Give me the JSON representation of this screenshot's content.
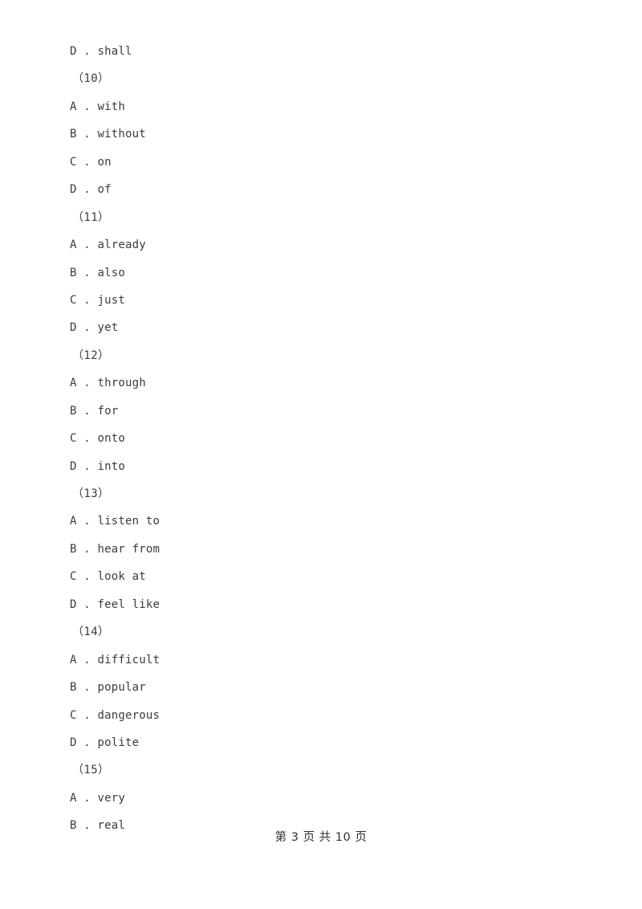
{
  "document": {
    "page_footer": "第 3 页 共 10 页",
    "text_color": "#3b3b3b",
    "background_color": "#ffffff"
  },
  "lines": [
    {
      "type": "option",
      "text": "D . shall"
    },
    {
      "type": "blanknum",
      "text": "（10）"
    },
    {
      "type": "option",
      "text": "A . with"
    },
    {
      "type": "option",
      "text": "B . without"
    },
    {
      "type": "option",
      "text": "C . on"
    },
    {
      "type": "option",
      "text": "D . of"
    },
    {
      "type": "blanknum",
      "text": "（11）"
    },
    {
      "type": "option",
      "text": "A . already"
    },
    {
      "type": "option",
      "text": "B . also"
    },
    {
      "type": "option",
      "text": "C . just"
    },
    {
      "type": "option",
      "text": "D . yet"
    },
    {
      "type": "blanknum",
      "text": "（12）"
    },
    {
      "type": "option",
      "text": "A . through"
    },
    {
      "type": "option",
      "text": "B . for"
    },
    {
      "type": "option",
      "text": "C . onto"
    },
    {
      "type": "option",
      "text": "D . into"
    },
    {
      "type": "blanknum",
      "text": "（13）"
    },
    {
      "type": "option",
      "text": "A . listen to"
    },
    {
      "type": "option",
      "text": "B . hear from"
    },
    {
      "type": "option",
      "text": "C . look at"
    },
    {
      "type": "option",
      "text": "D . feel like"
    },
    {
      "type": "blanknum",
      "text": "（14）"
    },
    {
      "type": "option",
      "text": "A . difficult"
    },
    {
      "type": "option",
      "text": "B . popular"
    },
    {
      "type": "option",
      "text": "C . dangerous"
    },
    {
      "type": "option",
      "text": "D . polite"
    },
    {
      "type": "blanknum",
      "text": "（15）"
    },
    {
      "type": "option",
      "text": "A . very"
    },
    {
      "type": "option",
      "text": "B . real"
    }
  ]
}
